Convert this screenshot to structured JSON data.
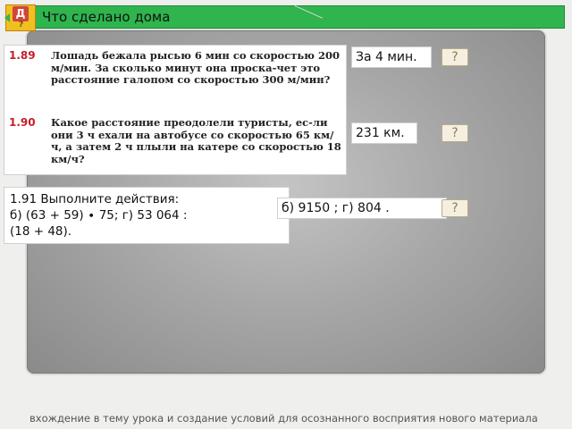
{
  "header": {
    "title": "Что сделано дома",
    "badge_letter": "Д",
    "badge_mark": "?"
  },
  "problems": [
    {
      "number": "1.89",
      "text": "Лошадь бежала рысью 6 мин со скоростью 200 м/мин. За сколько минут она проска-чет это расстояние галопом со скоростью 300 м/мин?"
    },
    {
      "number": "1.90",
      "text": "Какое расстояние преодолели туристы, ес-ли они 3 ч ехали на автобусе со скоростью 65 км/ч, а затем 2 ч плыли на катере со скоростью 18 км/ч?"
    }
  ],
  "answers": [
    {
      "text": "За 4 мин.",
      "button": "?"
    },
    {
      "text": "231 км.",
      "button": "?"
    },
    {
      "text": "б) 9150   ;    г) 804   .",
      "button": "?"
    }
  ],
  "task_191": {
    "line1": "1.91 Выполните действия:",
    "line2": "б) (63 + 59) ∙ 75;             г) 53 064 :",
    "line3": "(18 + 48)."
  },
  "footer": "вхождение в тему урока и создание условий для осознанного восприятия нового материала"
}
